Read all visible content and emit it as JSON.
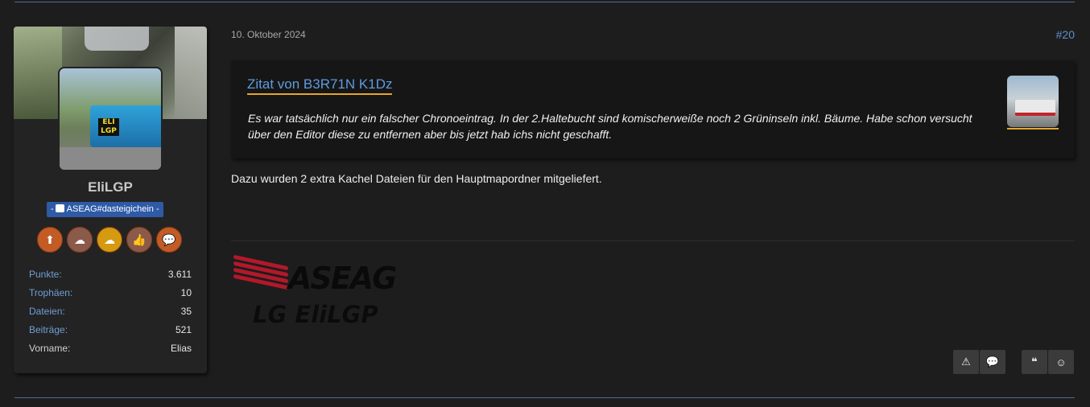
{
  "colors": {
    "background": "#1d1d1d",
    "accent_blue": "#5e9be0",
    "accent_orange": "#e6a62c",
    "badge_blue": "#2e5aa7",
    "trophy_orange": "#c25b25"
  },
  "author": {
    "username": "EliLGP",
    "rank_badge": "ASEAG#dasteigichein",
    "rank_badge_prefix": "-",
    "rank_badge_suffix": "-",
    "rank_icon": "bus-icon",
    "avatar_sign": "ELI LGP",
    "trophies": [
      {
        "icon": "upload-icon"
      },
      {
        "icon": "cloud-upload-icon"
      },
      {
        "icon": "cloud-upload-gold-icon"
      },
      {
        "icon": "thumbs-up-icon"
      },
      {
        "icon": "chat-bubbles-icon"
      }
    ],
    "stats": [
      {
        "label": "Punkte:",
        "value": "3.611"
      },
      {
        "label": "Trophäen:",
        "value": "10"
      },
      {
        "label": "Dateien:",
        "value": "35"
      },
      {
        "label": "Beiträge:",
        "value": "521"
      },
      {
        "label": "Vorname:",
        "value": "Elias"
      }
    ]
  },
  "post": {
    "date": "10. Oktober 2024",
    "number": "#20",
    "quote": {
      "title": "Zitat von B3R71N K1Dz",
      "body": "Es war tatsächlich nur ein falscher Chronoeintrag. In der 2.Haltebucht sind komischerweiße noch 2 Grüninseln inkl. Bäume. Habe schon versucht über den Editor diese zu entfernen aber bis jetzt hab ichs nicht geschafft."
    },
    "text": "Dazu wurden 2 extra Kachel Dateien für den Hauptmapordner mitgeliefert.",
    "signature": {
      "brand": "ASEAG",
      "line": "LG EliLGP"
    },
    "actions": {
      "report_icon": "warning-icon",
      "reply_icon": "comments-icon",
      "quote_icon": "quote-icon",
      "react_icon": "smiley-icon"
    }
  }
}
